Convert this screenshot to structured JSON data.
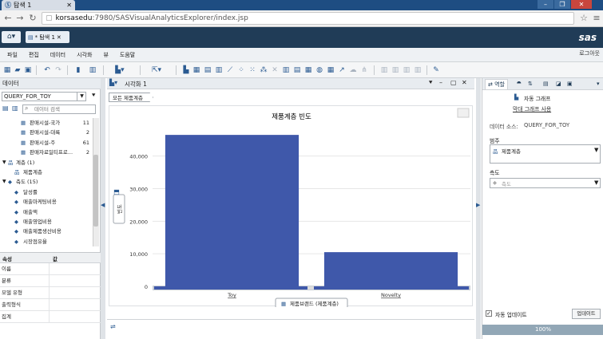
{
  "browser": {
    "tab_title": "탐색 1",
    "url_host": "korsasedu",
    "url_path": ":7980/SASVisualAnalyticsExplorer/index.jsp",
    "window_controls": [
      "–",
      "❐",
      "✕"
    ]
  },
  "app": {
    "doc_tab_label": "* 탐색 1",
    "logo_text": "sas",
    "logout_label": "로그아웃"
  },
  "menu": [
    "파일",
    "편집",
    "데이터",
    "시각화",
    "뷰",
    "도움말"
  ],
  "data_pane": {
    "title": "데이터",
    "datasource": "QUERY_FOR_TOY",
    "search_placeholder": "데이터 검색",
    "tree": [
      {
        "label": "판매시설-국가",
        "count": "11",
        "indent": 2,
        "icon": "date"
      },
      {
        "label": "판매시설-대륙",
        "count": "2",
        "indent": 2,
        "icon": "date"
      },
      {
        "label": "판매시설-주",
        "count": "61",
        "indent": 2,
        "icon": "date"
      },
      {
        "label": "판매자료일티프로...",
        "count": "2",
        "indent": 2,
        "icon": "date"
      },
      {
        "label": "계층 (1)",
        "count": "",
        "indent": 0,
        "icon": "hier",
        "group": true
      },
      {
        "label": "제품계층",
        "count": "",
        "indent": 1,
        "icon": "hier"
      },
      {
        "label": "측도 (15)",
        "count": "",
        "indent": 0,
        "icon": "measure",
        "group": true
      },
      {
        "label": "달성률",
        "count": "",
        "indent": 1,
        "icon": "measure"
      },
      {
        "label": "매출마케팅비용",
        "count": "",
        "indent": 1,
        "icon": "measure"
      },
      {
        "label": "매출액",
        "count": "",
        "indent": 1,
        "icon": "measure"
      },
      {
        "label": "매출영업비용",
        "count": "",
        "indent": 1,
        "icon": "measure"
      },
      {
        "label": "매출제품생산비용",
        "count": "",
        "indent": 1,
        "icon": "measure"
      },
      {
        "label": "시장점유율",
        "count": "",
        "indent": 1,
        "icon": "measure"
      }
    ],
    "props_headers": [
      "속성",
      "값"
    ],
    "props_rows": [
      "이름",
      "분류",
      "모델 유형",
      "출력형식",
      "집계"
    ]
  },
  "center": {
    "title": "시각화 1",
    "breadcrumb": "모든 제품계층"
  },
  "chart_data": {
    "type": "bar",
    "title": "제품계층 빈도",
    "categories": [
      "Toy",
      "Novelty"
    ],
    "values": [
      46500,
      10500
    ],
    "xlabel": "제품브랜드 (제품계층)",
    "ylabel": "빈도",
    "ylim": [
      0,
      48000
    ],
    "yticks": [
      "0",
      "10,000",
      "20,000",
      "30,000",
      "40,000"
    ],
    "ytick_values": [
      0,
      10000,
      20000,
      30000,
      40000
    ],
    "bar_color": "#3f58aa",
    "grid": true
  },
  "right_pane": {
    "tab_role": "역할",
    "chart_type": "자동 그래프",
    "use_bar_chart": "막대 그래프 사용",
    "data_source_label": "데이터 소스:",
    "data_source_value": "QUERY_FOR_TOY",
    "category_label": "범주",
    "category_value": "제품계층",
    "measure_label": "측도",
    "measure_placeholder": "측도",
    "auto_update_label": "자동 업데이트",
    "update_button": "업데이트",
    "progress": "100%"
  }
}
